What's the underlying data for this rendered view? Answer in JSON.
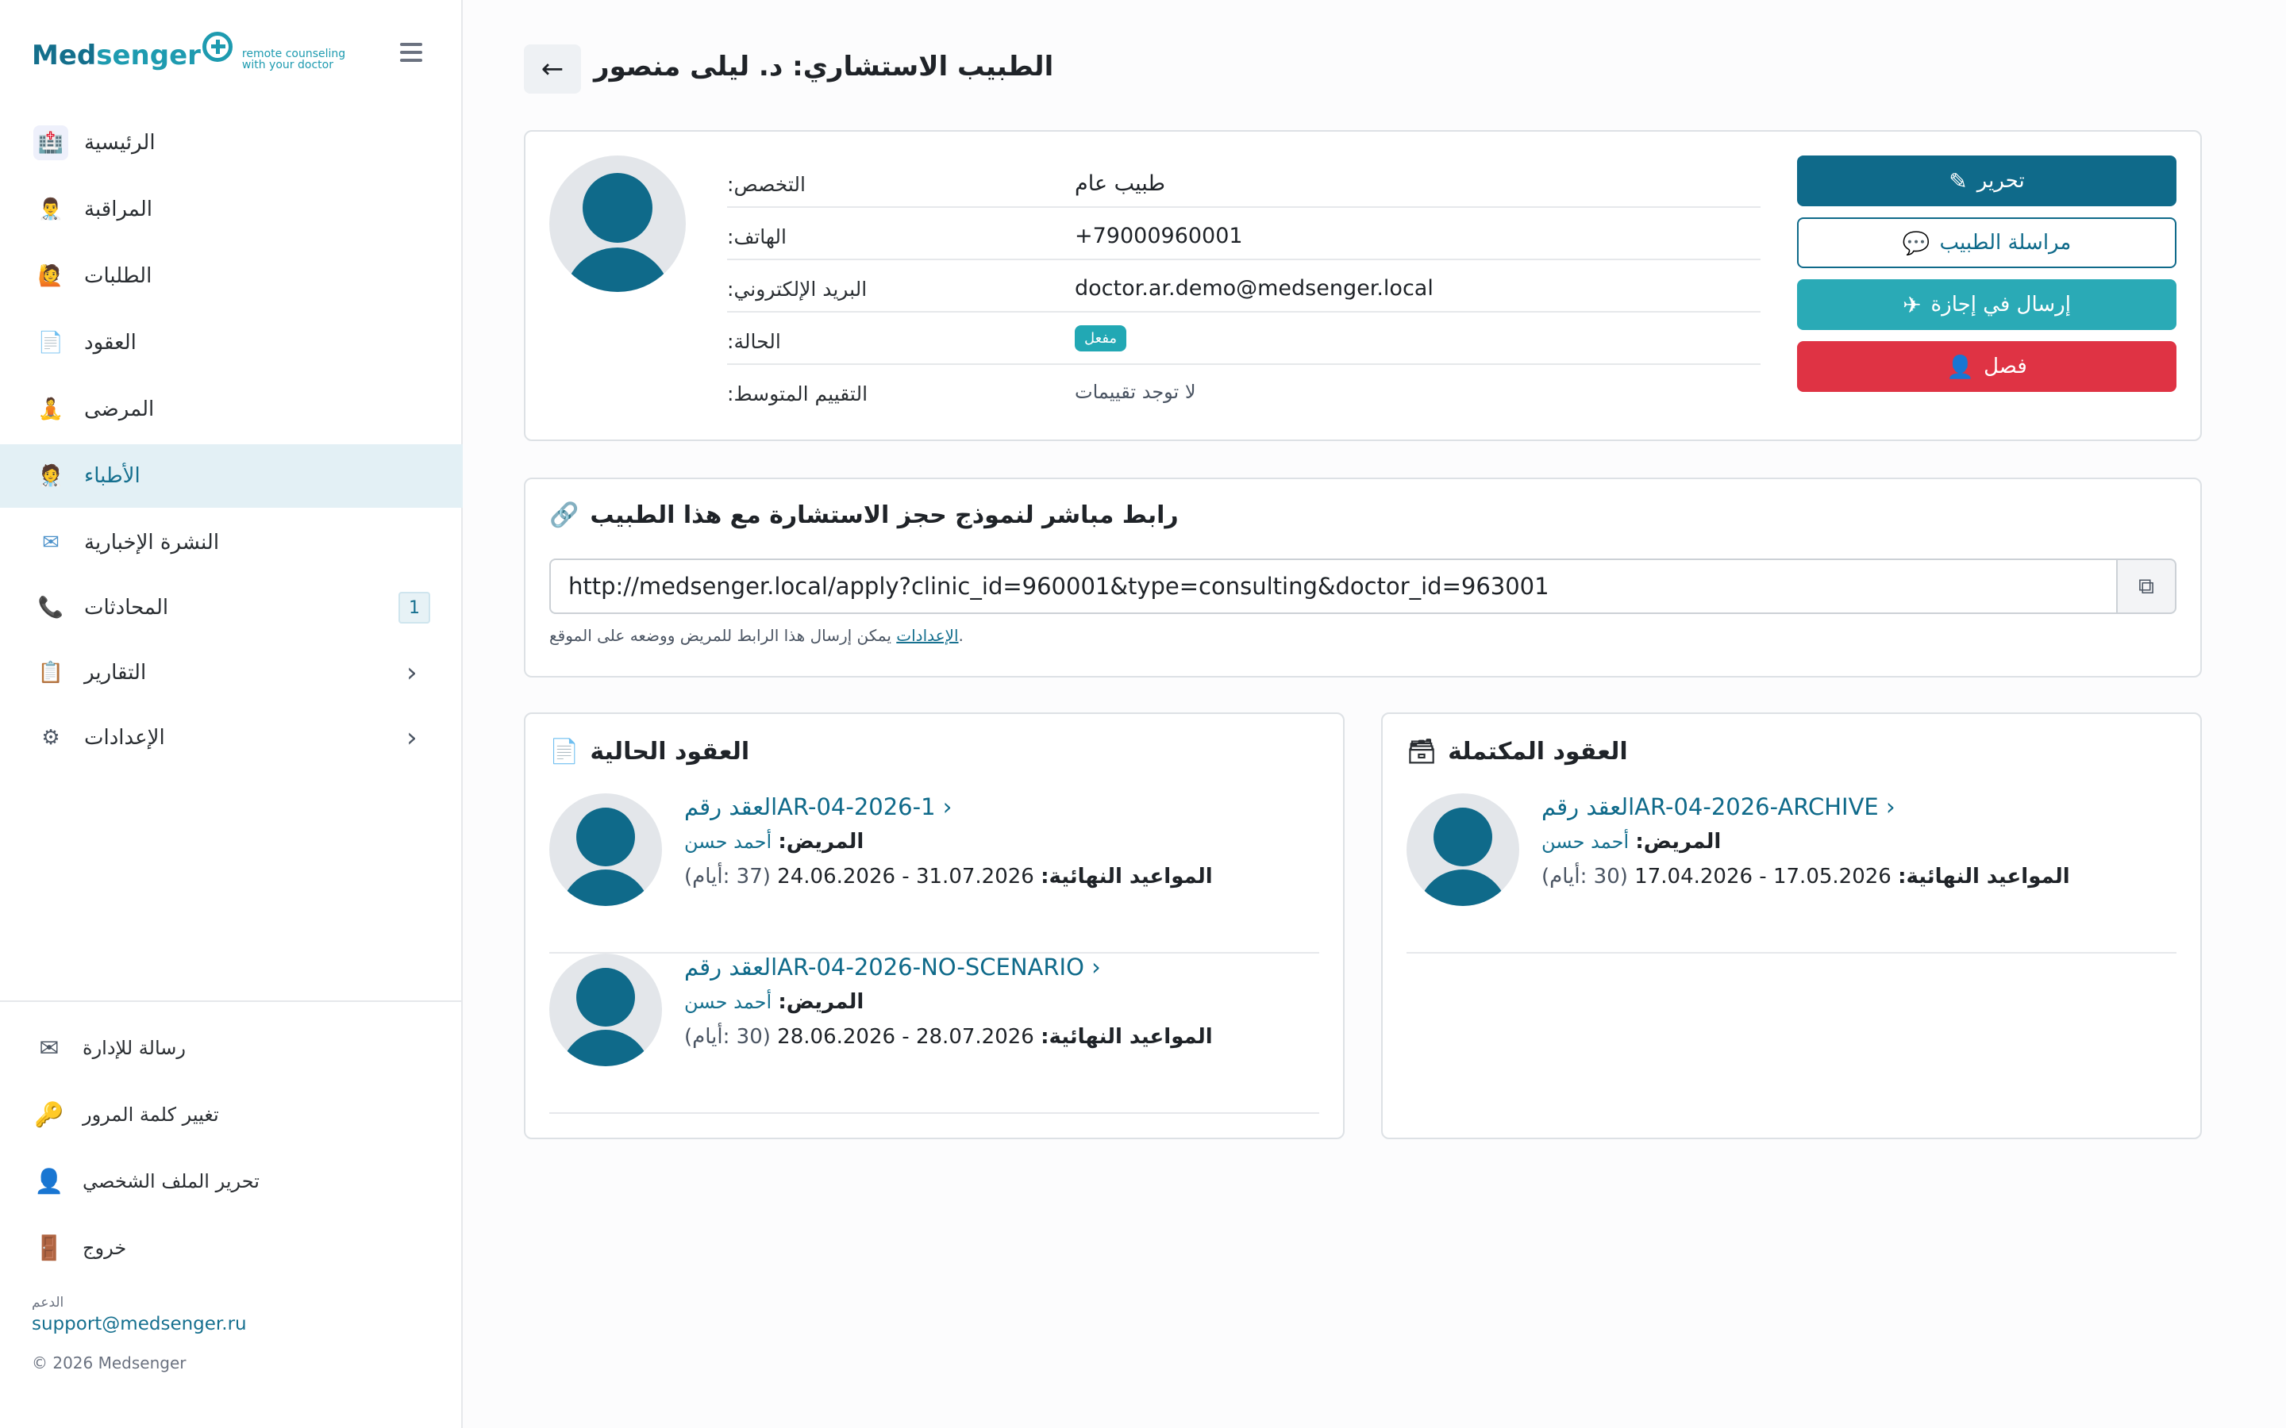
{
  "brand": {
    "name_a": "Med",
    "name_b": "senger",
    "tagline_1": "remote counseling",
    "tagline_2": "with your doctor"
  },
  "sidebar": {
    "items": [
      {
        "label": "الرئيسية",
        "icon": "hospital-icon"
      },
      {
        "label": "المراقبة",
        "icon": "doctor-monitoring-icon"
      },
      {
        "label": "الطلبات",
        "icon": "requests-icon"
      },
      {
        "label": "العقود",
        "icon": "contracts-icon"
      },
      {
        "label": "المرضى",
        "icon": "patients-icon"
      },
      {
        "label": "الأطباء",
        "icon": "doctors-icon",
        "active": true
      },
      {
        "label": "النشرة الإخبارية",
        "icon": "newsletter-icon"
      },
      {
        "label": "المحادثات",
        "icon": "chats-icon",
        "badge": "1"
      },
      {
        "label": "التقارير",
        "icon": "reports-icon"
      },
      {
        "label": "الإعدادات",
        "icon": "settings-icon"
      }
    ],
    "footer": [
      {
        "label": "رسالة للإدارة",
        "icon": "envelope-icon"
      },
      {
        "label": "تغيير كلمة المرور",
        "icon": "key-icon"
      },
      {
        "label": "تحرير الملف الشخصي",
        "icon": "user-edit-icon"
      },
      {
        "label": "خروج",
        "icon": "logout-icon"
      }
    ],
    "support_caption": "الدعم",
    "support_email": "support@medsenger.ru",
    "copyright": "© 2026 Medsenger"
  },
  "header": {
    "title": "الطبيب الاستشاري: د. ليلى منصور"
  },
  "profile": {
    "rows": [
      {
        "label": ":التخصص",
        "value": "طبيب عام"
      },
      {
        "label": ":الهاتف",
        "value": "+79000960001"
      },
      {
        "label": ":البريد الإلكتروني",
        "value": "doctor.ar.demo@medsenger.local"
      },
      {
        "label": ":الحالة",
        "value": "مفعل"
      },
      {
        "label": ":التقييم المتوسط",
        "value": "لا توجد تقييمات"
      }
    ],
    "buttons": {
      "edit": "تحرير",
      "message": "مراسلة الطبيب",
      "vacation": "إرسال في إجازة",
      "dismiss": "فصل"
    }
  },
  "booking": {
    "title": "رابط مباشر لنموذج حجز الاستشارة مع هذا الطبيب",
    "url": "http://medsenger.local/apply?clinic_id=960001&type=consulting&doctor_id=963001",
    "hint": "يمكن إرسال هذا الرابط للمريض ووضعه على الموقع.",
    "hint_link": "الإعدادات"
  },
  "current_contracts": {
    "title": "العقود الحالية",
    "items": [
      {
        "link": "العقد رقمAR-04-2026-1",
        "patient_label": "المريض:",
        "patient": "أحمد حسن",
        "dates_label": "المواعيد النهائية:",
        "dates": "31.07.2026 - 24.06.2026",
        "days": "(37 :أيام)"
      },
      {
        "link": "العقد رقمAR-04-2026-NO-SCENARIO",
        "patient_label": "المريض:",
        "patient": "أحمد حسن",
        "dates_label": "المواعيد النهائية:",
        "dates": "28.07.2026 - 28.06.2026",
        "days": "(30 :أيام)"
      }
    ]
  },
  "completed_contracts": {
    "title": "العقود المكتملة",
    "items": [
      {
        "link": "العقد رقمAR-04-2026-ARCHIVE",
        "patient_label": "المريض:",
        "patient": "أحمد حسن",
        "dates_label": "المواعيد النهائية:",
        "dates": "17.05.2026 - 17.04.2026",
        "days": "(30 :أيام)"
      }
    ]
  },
  "colors": {
    "primary": "#0f6a8a",
    "teal": "#2aaab6",
    "danger": "#df3344",
    "active_bg": "#e3f0f5"
  }
}
